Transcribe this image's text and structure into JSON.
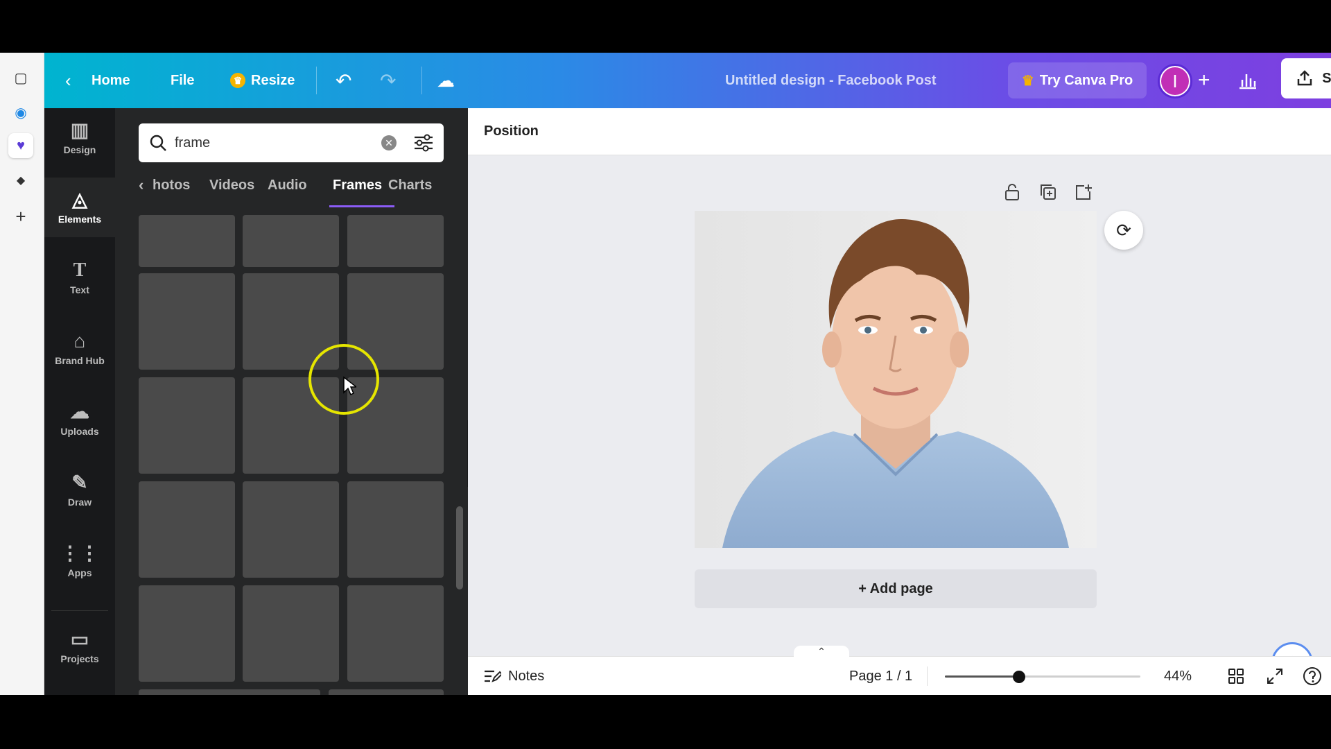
{
  "topbar": {
    "home_label": "Home",
    "file_label": "File",
    "resize_label": "Resize",
    "doc_title": "Untitled design - Facebook Post",
    "try_pro_label": "Try Canva Pro",
    "avatar_initial": "I",
    "share_label": "Share"
  },
  "sidenav": {
    "items": [
      {
        "label": "Design",
        "icon": "layout-icon"
      },
      {
        "label": "Elements",
        "icon": "shapes-icon"
      },
      {
        "label": "Text",
        "icon": "text-icon"
      },
      {
        "label": "Brand Hub",
        "icon": "brand-icon"
      },
      {
        "label": "Uploads",
        "icon": "upload-cloud-icon"
      },
      {
        "label": "Draw",
        "icon": "draw-icon"
      },
      {
        "label": "Apps",
        "icon": "apps-grid-icon"
      },
      {
        "label": "Projects",
        "icon": "folder-icon"
      }
    ]
  },
  "panel": {
    "search_value": "frame",
    "tabs": [
      "hotos",
      "Videos",
      "Audio",
      "Frames",
      "Charts"
    ],
    "active_tab": "Frames"
  },
  "editor": {
    "context_label": "Position",
    "add_page_label": "+ Add page"
  },
  "bottombar": {
    "notes_label": "Notes",
    "page_indicator": "Page 1 / 1",
    "zoom_label": "44%",
    "zoom_value": 0.38
  },
  "colors": {
    "accent_purple": "#8b5cf6",
    "panel_bg": "#252627",
    "nav_bg": "#18191b",
    "cursor_highlight": "#e6e600"
  }
}
